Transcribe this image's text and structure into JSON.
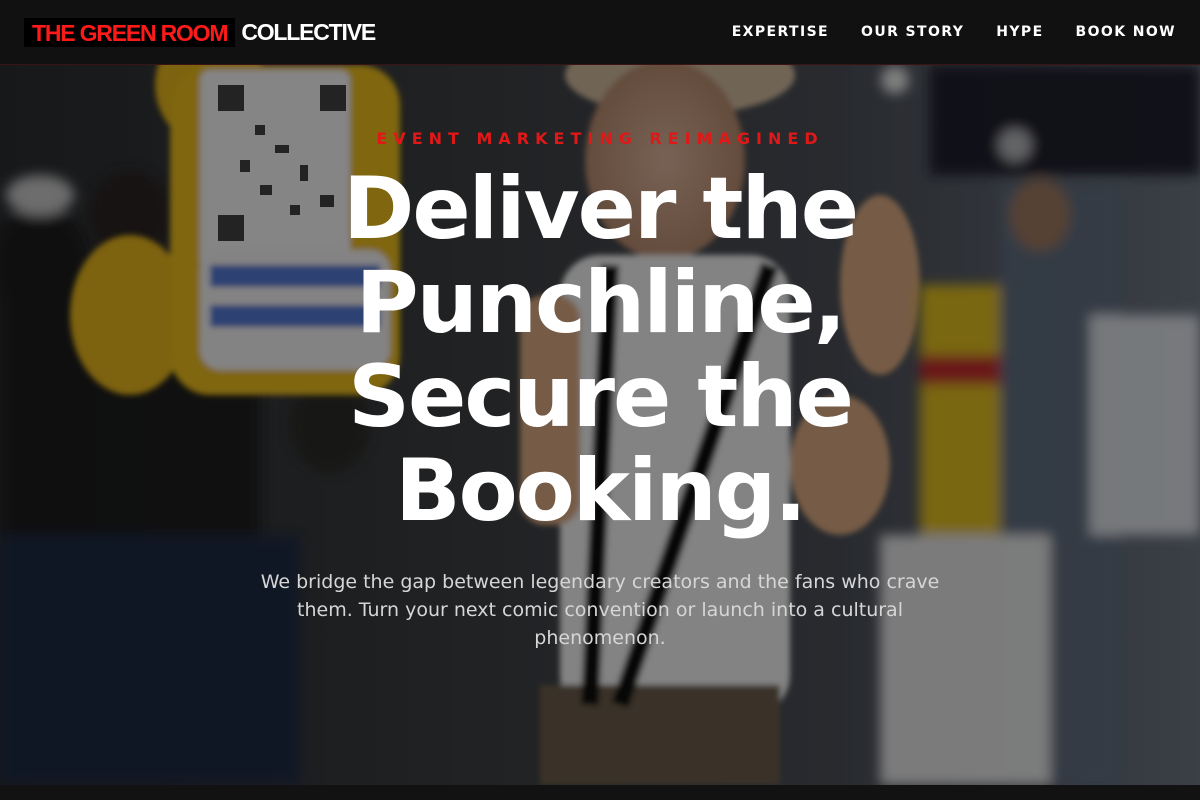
{
  "header": {
    "logo_red": "THE GREEN ROOM",
    "logo_white": "COLLECTIVE",
    "nav": [
      {
        "label": "EXPERTISE"
      },
      {
        "label": "OUR STORY"
      },
      {
        "label": "HYPE"
      },
      {
        "label": "BOOK NOW"
      }
    ]
  },
  "hero": {
    "eyebrow": "EVENT MARKETING REIMAGINED",
    "headline": "Deliver the Punchline, Secure the Booking.",
    "subtext": "We bridge the gap between legendary creators and the fans who crave them. Turn your next comic convention or launch into a cultural phenomenon.",
    "background_image": "convention-promoter-photo"
  },
  "colors": {
    "accent": "#e01818",
    "header_bg": "#111111",
    "text": "#ffffff"
  }
}
